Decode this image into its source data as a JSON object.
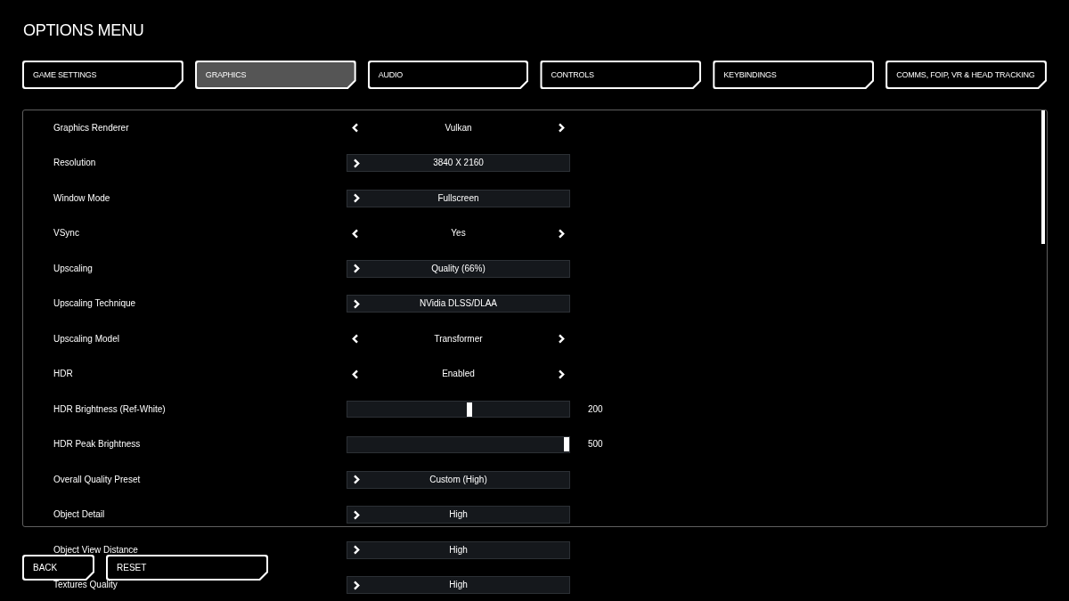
{
  "title": "OPTIONS MENU",
  "tabs": [
    {
      "label": "GAME SETTINGS",
      "selected": false
    },
    {
      "label": "GRAPHICS",
      "selected": true
    },
    {
      "label": "AUDIO",
      "selected": false
    },
    {
      "label": "CONTROLS",
      "selected": false
    },
    {
      "label": "KEYBINDINGS",
      "selected": false
    },
    {
      "label": "COMMS, FOIP, VR & HEAD TRACKING",
      "selected": false
    }
  ],
  "settings": [
    {
      "kind": "selector",
      "label": "Graphics Renderer",
      "value": "Vulkan"
    },
    {
      "kind": "dropdown",
      "label": "Resolution",
      "value": "3840 X 2160"
    },
    {
      "kind": "dropdown",
      "label": "Window Mode",
      "value": "Fullscreen"
    },
    {
      "kind": "selector",
      "label": "VSync",
      "value": "Yes"
    },
    {
      "kind": "dropdown",
      "label": "Upscaling",
      "value": "Quality (66%)"
    },
    {
      "kind": "dropdown",
      "label": "Upscaling Technique",
      "value": "NVidia DLSS/DLAA"
    },
    {
      "kind": "selector",
      "label": "Upscaling Model",
      "value": "Transformer"
    },
    {
      "kind": "selector",
      "label": "HDR",
      "value": "Enabled"
    },
    {
      "kind": "slider",
      "label": "HDR Brightness (Ref-White)",
      "level": 0.55,
      "reading": "200"
    },
    {
      "kind": "slider",
      "label": "HDR Peak Brightness",
      "level": 1,
      "reading": "500"
    },
    {
      "kind": "dropdown",
      "label": "Overall Quality Preset",
      "value": "Custom (High)"
    },
    {
      "kind": "dropdown",
      "label": "Object Detail",
      "value": "High"
    },
    {
      "kind": "dropdown",
      "label": "Object View Distance",
      "value": "High"
    },
    {
      "kind": "dropdown",
      "label": "Textures Quality",
      "value": "High"
    }
  ],
  "buttons": [
    "BACK",
    "RESET"
  ]
}
